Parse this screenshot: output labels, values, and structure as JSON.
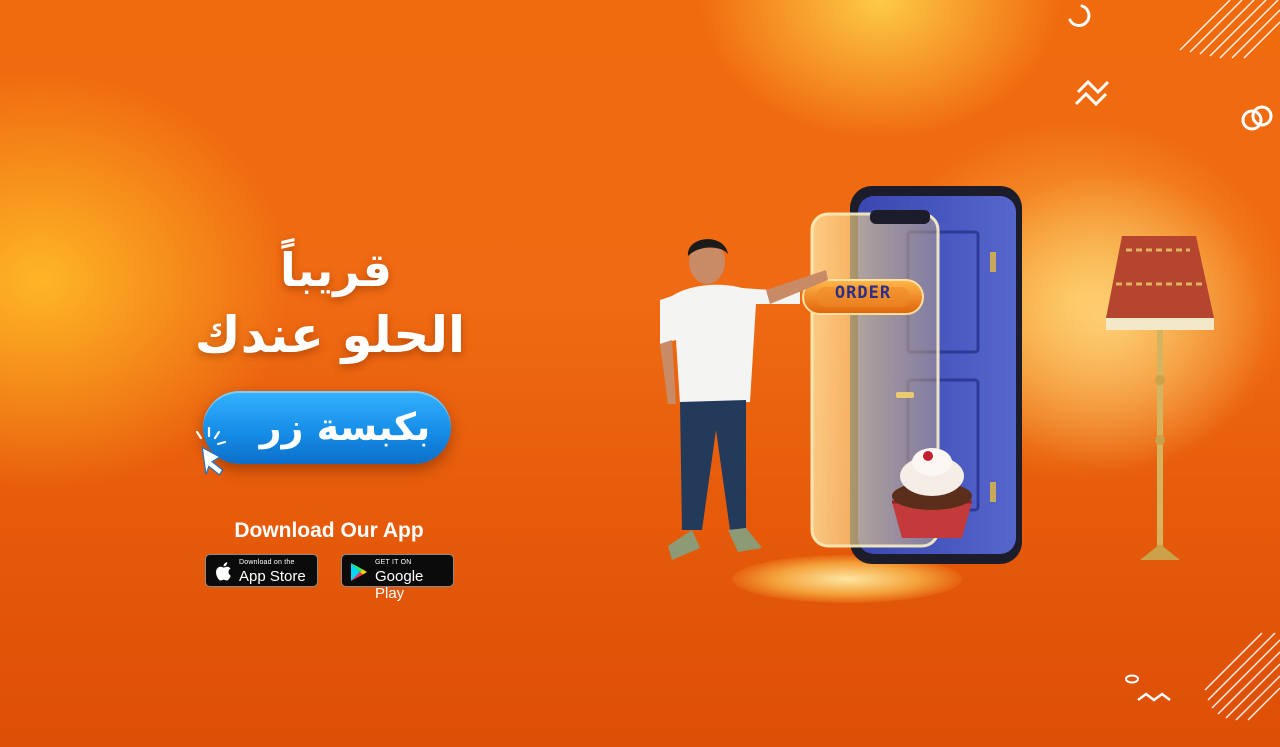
{
  "hero": {
    "headline_line1": "قريباً",
    "headline_line2": "الحلو عندك",
    "cta_label": "بكبسة زر",
    "order_label": "ORDER"
  },
  "download": {
    "title": "Download Our App",
    "app_store": {
      "small": "Download on the",
      "big": "App Store"
    },
    "google_play": {
      "small": "GET IT ON",
      "big": "Google Play"
    }
  },
  "icons": [
    "cursor-click-icon",
    "apple-icon",
    "google-play-icon"
  ],
  "colors": {
    "background": "#ef6a12",
    "cta_blue": "#168ee8",
    "text": "#ffffff",
    "door_blue": "#4a5bc4"
  }
}
